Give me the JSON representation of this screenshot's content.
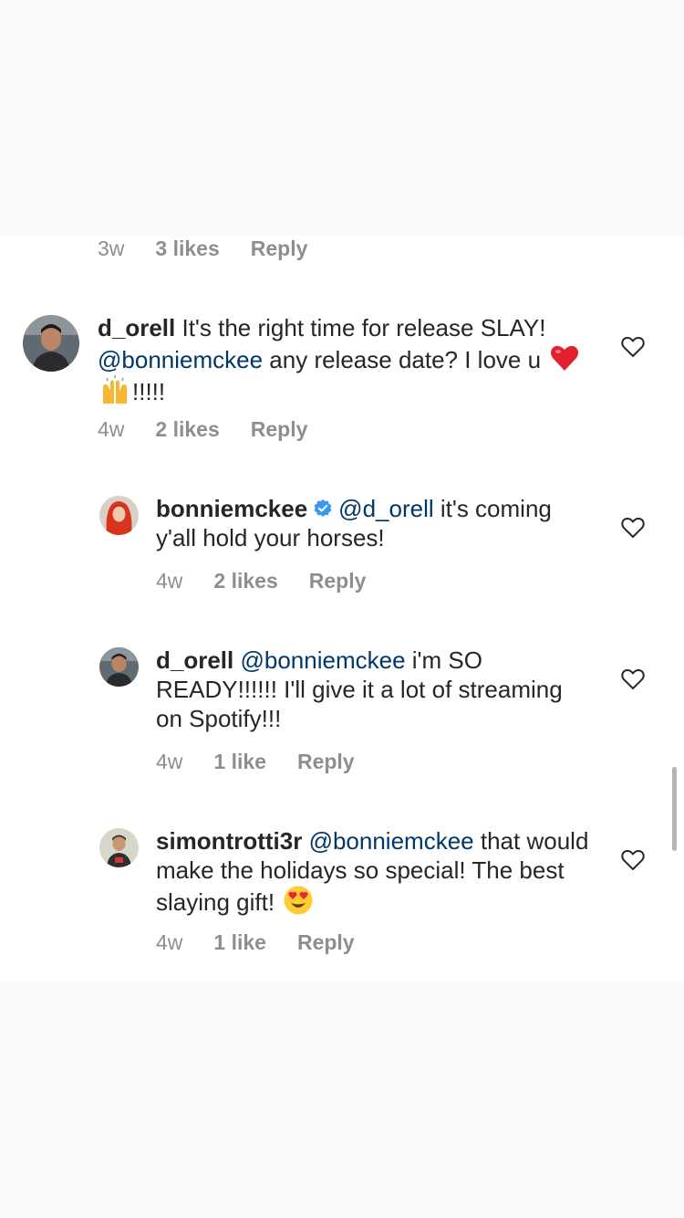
{
  "comments": [
    {
      "meta": {
        "time": "3w",
        "likes": "3 likes",
        "reply": "Reply"
      }
    },
    {
      "username": "d_orell",
      "text_a": "It's the right time for release SLAY!",
      "mention": "@bonniemckee",
      "text_b": "any release date? I love u",
      "text_c": "!!!!!",
      "emojis": [
        "red-heart-emoji",
        "raising-hands-emoji"
      ],
      "meta": {
        "time": "4w",
        "likes": "2 likes",
        "reply": "Reply"
      }
    }
  ],
  "replies": [
    {
      "username": "bonniemckee",
      "verified": true,
      "mention": "@d_orell",
      "text": "it's coming y'all hold your horses!",
      "meta": {
        "time": "4w",
        "likes": "2 likes",
        "reply": "Reply"
      }
    },
    {
      "username": "d_orell",
      "mention": "@bonniemckee",
      "text": "i'm SO READY!!!!!! I'll give it a lot of streaming on Spotify!!!",
      "meta": {
        "time": "4w",
        "likes": "1 like",
        "reply": "Reply"
      }
    },
    {
      "username": "simontrotti3r",
      "mention": "@bonniemckee",
      "text": "that would make the holidays so special! The best slaying gift!",
      "emojis": [
        "heart-eyes-emoji"
      ],
      "meta": {
        "time": "4w",
        "likes": "1 like",
        "reply": "Reply"
      }
    }
  ],
  "icons": {
    "like": "heart-outline-icon",
    "verified": "verified-badge-icon"
  },
  "colors": {
    "mention": "#00376b",
    "meta": "#8e8e8e",
    "verified": "#3897f0",
    "background": "#fafafa"
  }
}
